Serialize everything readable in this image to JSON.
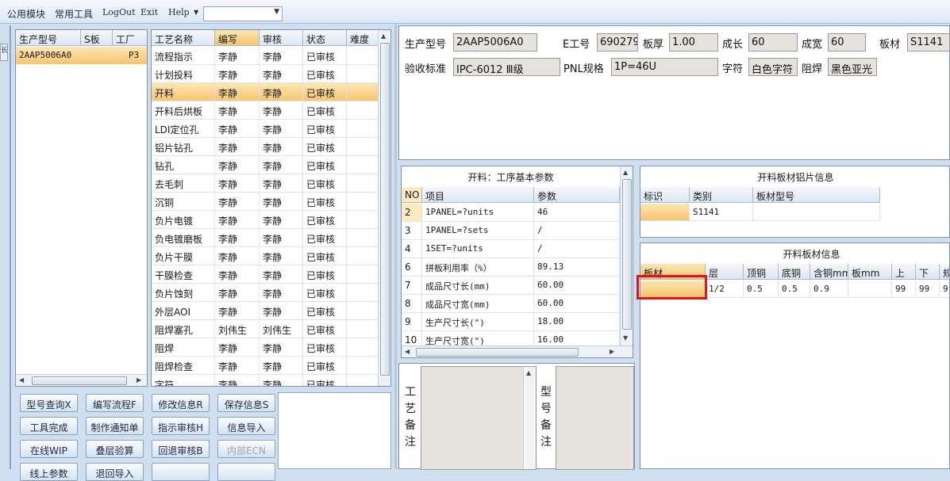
{
  "menu": {
    "items": [
      "公用模块",
      "常用工具",
      "LogOut",
      "Exit",
      "Help"
    ],
    "combo_value": ""
  },
  "edge_tab": "长",
  "part_grid": {
    "headers": [
      "生产型号",
      "S板",
      "工厂"
    ],
    "rows": [
      [
        "2AAP5006A0",
        "",
        "P3"
      ]
    ]
  },
  "process_grid": {
    "headers": [
      "工艺名称",
      "编写",
      "审核",
      "状态",
      "难度"
    ],
    "rows": [
      [
        "流程指示",
        "李静",
        "李静",
        "已审核",
        ""
      ],
      [
        "计划投料",
        "李静",
        "李静",
        "已审核",
        ""
      ],
      [
        "开料",
        "李静",
        "李静",
        "已审核",
        ""
      ],
      [
        "开料后烘板",
        "李静",
        "李静",
        "已审核",
        ""
      ],
      [
        "LDI定位孔",
        "李静",
        "李静",
        "已审核",
        ""
      ],
      [
        "铝片钻孔",
        "李静",
        "李静",
        "已审核",
        ""
      ],
      [
        "钻孔",
        "李静",
        "李静",
        "已审核",
        ""
      ],
      [
        "去毛刺",
        "李静",
        "李静",
        "已审核",
        ""
      ],
      [
        "沉铜",
        "李静",
        "李静",
        "已审核",
        ""
      ],
      [
        "负片电镀",
        "李静",
        "李静",
        "已审核",
        ""
      ],
      [
        "负电镀磨板",
        "李静",
        "李静",
        "已审核",
        ""
      ],
      [
        "负片干膜",
        "李静",
        "李静",
        "已审核",
        ""
      ],
      [
        "干膜检查",
        "李静",
        "李静",
        "已审核",
        ""
      ],
      [
        "负片蚀刻",
        "李静",
        "李静",
        "已审核",
        ""
      ],
      [
        "外层AOI",
        "李静",
        "李静",
        "已审核",
        ""
      ],
      [
        "阻焊塞孔",
        "刘伟生",
        "刘伟生",
        "已审核",
        ""
      ],
      [
        "阻焊",
        "李静",
        "李静",
        "已审核",
        ""
      ],
      [
        "阻焊检查",
        "李静",
        "李静",
        "已审核",
        ""
      ],
      [
        "字符",
        "李静",
        "李静",
        "已审核",
        ""
      ]
    ],
    "selected_index": 2
  },
  "buttons": [
    [
      "型号查询X",
      "编写流程F",
      "修改信息R",
      "保存信息S"
    ],
    [
      "工具完成",
      "制作通知单",
      "指示审核H",
      "信息导入"
    ],
    [
      "在线WIP",
      "叠层验算",
      "回退审核B",
      "内部ECN"
    ],
    [
      "线上参数",
      "退回导入",
      "",
      ""
    ]
  ],
  "disabled_buttons": [
    "内部ECN"
  ],
  "info": {
    "fields": [
      {
        "label": "生产型号",
        "value": "2AAP5006A0"
      },
      {
        "label": "E工号",
        "value": "690279"
      },
      {
        "label": "板厚",
        "value": "1.00"
      },
      {
        "label": "成长",
        "value": "60"
      },
      {
        "label": "成宽",
        "value": "60"
      },
      {
        "label": "板材",
        "value": "S1141"
      },
      {
        "label": "验收标准",
        "value": "IPC-6012 Ⅲ级"
      },
      {
        "label": "PNL规格",
        "value": "1P=46U"
      },
      {
        "label": "字符",
        "value": "白色字符"
      },
      {
        "label": "阻焊",
        "value": "黑色亚光"
      }
    ]
  },
  "params": {
    "title": "开料：工序基本参数",
    "headers": [
      "NO",
      "项目",
      "参数"
    ],
    "rows": [
      [
        "2",
        "1PANEL=?units",
        "46"
      ],
      [
        "3",
        "1PANEL=?sets",
        "/"
      ],
      [
        "4",
        "1SET=?units",
        "/"
      ],
      [
        "6",
        "拼板利用率（%）",
        "89.13"
      ],
      [
        "7",
        "成品尺寸长(mm)",
        "60.00"
      ],
      [
        "8",
        "成品尺寸宽(mm)",
        "60.00"
      ],
      [
        "9",
        "生产尺寸长(\")",
        "18.00"
      ],
      [
        "10",
        "生产尺寸宽(\")",
        "16.00"
      ]
    ]
  },
  "aluminum": {
    "title": "开料板材铝片信息",
    "headers": [
      "标识",
      "类别",
      "板材型号"
    ],
    "rows": [
      [
        "",
        "S1141",
        ""
      ]
    ]
  },
  "board": {
    "title": "开料板材信息",
    "headers": [
      "板材",
      "层",
      "顶铜",
      "底铜",
      "含铜mm",
      "板mm",
      "上",
      "下",
      "规"
    ],
    "rows": [
      [
        "",
        "1/2",
        "0.5",
        "0.5",
        "0.9",
        "",
        "99",
        "99",
        "9"
      ]
    ]
  },
  "notes": {
    "process_label": [
      "工",
      "艺",
      "备",
      "注"
    ],
    "model_label": [
      "型",
      "号",
      "备",
      "注"
    ]
  },
  "colors": {
    "selection": "#f6c46e",
    "highlight_box": "#e0141c",
    "field_bg": "#e6e3dd"
  }
}
